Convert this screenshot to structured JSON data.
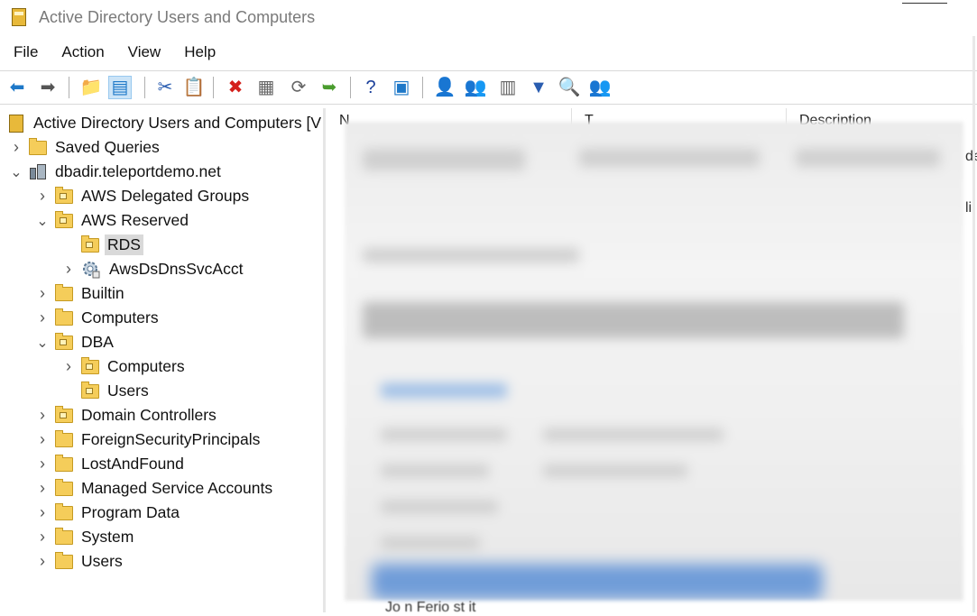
{
  "window": {
    "title": "Active Directory Users and Computers"
  },
  "menu": [
    "File",
    "Action",
    "View",
    "Help"
  ],
  "toolbar": {
    "buttons": [
      {
        "name": "back-button",
        "glyph": "⬅",
        "color": "#1e78c8"
      },
      {
        "name": "forward-button",
        "glyph": "➡",
        "color": "#555555"
      },
      {
        "name": "up-folder-button",
        "glyph": "📁",
        "color": "#c79a22"
      },
      {
        "name": "show-hide-console-tree-button",
        "glyph": "▤",
        "color": "#1e78c8"
      },
      {
        "name": "cut-button",
        "glyph": "✂",
        "color": "#2a5db0"
      },
      {
        "name": "copy-button",
        "glyph": "📋",
        "color": "#444444"
      },
      {
        "name": "delete-button",
        "glyph": "✖",
        "color": "#d4201b"
      },
      {
        "name": "properties-button",
        "glyph": "▦",
        "color": "#666666"
      },
      {
        "name": "refresh-button",
        "glyph": "⟳",
        "color": "#666666"
      },
      {
        "name": "export-list-button",
        "glyph": "➥",
        "color": "#4a9c2e"
      },
      {
        "name": "help-button",
        "glyph": "?",
        "color": "#1a3f9a"
      },
      {
        "name": "action-pane-button",
        "glyph": "▣",
        "color": "#1e78c8"
      },
      {
        "name": "new-user-button",
        "glyph": "👤",
        "color": "#333333"
      },
      {
        "name": "new-group-button",
        "glyph": "👥",
        "color": "#333333"
      },
      {
        "name": "new-ou-button",
        "glyph": "▥",
        "color": "#666666"
      },
      {
        "name": "filter-button",
        "glyph": "▼",
        "color": "#2a5db0"
      },
      {
        "name": "find-button",
        "glyph": "🔍",
        "color": "#c79a22"
      },
      {
        "name": "add-to-group-button",
        "glyph": "👥",
        "color": "#1e78c8"
      }
    ]
  },
  "tree": {
    "root": "Active Directory Users and Computers [V",
    "items": [
      {
        "label": "Saved Queries",
        "level": 1,
        "expander": "›",
        "icon": "folder"
      },
      {
        "label": "dbadir.teleportdemo.net",
        "level": 1,
        "expander": "⌄",
        "icon": "domain"
      },
      {
        "label": "AWS Delegated Groups",
        "level": 2,
        "expander": "›",
        "icon": "ou"
      },
      {
        "label": "AWS Reserved",
        "level": 2,
        "expander": "⌄",
        "icon": "ou"
      },
      {
        "label": "RDS",
        "level": 3,
        "expander": "",
        "icon": "ou",
        "selected": true
      },
      {
        "label": "AwsDsDnsSvcAcct",
        "level": 3,
        "expander": "›",
        "icon": "gear"
      },
      {
        "label": "Builtin",
        "level": 2,
        "expander": "›",
        "icon": "folder"
      },
      {
        "label": "Computers",
        "level": 2,
        "expander": "›",
        "icon": "folder"
      },
      {
        "label": "DBA",
        "level": 2,
        "expander": "⌄",
        "icon": "ou"
      },
      {
        "label": "Computers",
        "level": 3,
        "expander": "›",
        "icon": "ou"
      },
      {
        "label": "Users",
        "level": 3,
        "expander": "",
        "icon": "ou"
      },
      {
        "label": "Domain Controllers",
        "level": 2,
        "expander": "›",
        "icon": "ou"
      },
      {
        "label": "ForeignSecurityPrincipals",
        "level": 2,
        "expander": "›",
        "icon": "folder"
      },
      {
        "label": "LostAndFound",
        "level": 2,
        "expander": "›",
        "icon": "folder"
      },
      {
        "label": "Managed Service Accounts",
        "level": 2,
        "expander": "›",
        "icon": "folder"
      },
      {
        "label": "Program Data",
        "level": 2,
        "expander": "›",
        "icon": "folder"
      },
      {
        "label": "System",
        "level": 2,
        "expander": "›",
        "icon": "folder"
      },
      {
        "label": "Users",
        "level": 2,
        "expander": "›",
        "icon": "folder"
      }
    ]
  },
  "list": {
    "columns": [
      "N",
      "T",
      "Description"
    ],
    "fragments": {
      "right_top": "de",
      "right_mid": "li",
      "bottom": "Jo  n Ferio          st  it"
    }
  },
  "colors": {
    "selection": "#d9d9d9",
    "folder": "#f5cd5a",
    "accent_blue": "#1e78c8"
  }
}
